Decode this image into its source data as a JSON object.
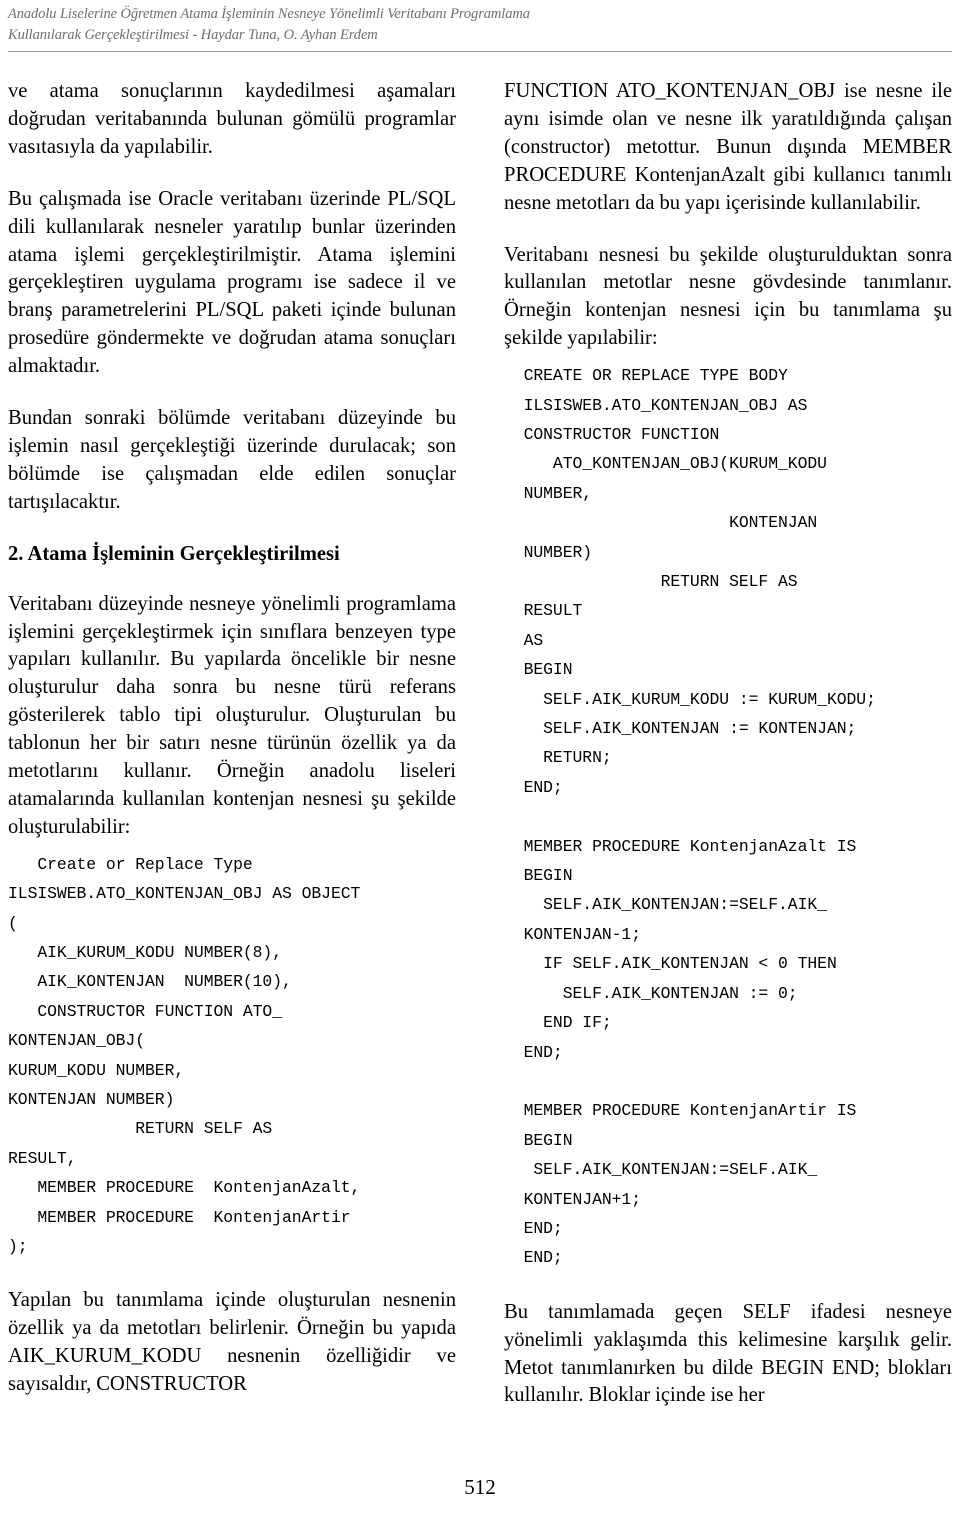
{
  "header": {
    "line1": "Anadolu Liselerine Öğretmen Atama İşleminin Nesneye Yönelimli Veritabanı Programlama",
    "line2": "Kullanılarak Gerçekleştirilmesi - Haydar Tuna, O. Ayhan Erdem"
  },
  "left_column": {
    "para1": "ve atama sonuçlarının kaydedilmesi aşamaları doğrudan veritabanında bulunan gömülü programlar vasıtasıyla da yapılabilir.",
    "para2": "Bu çalışmada ise Oracle veritabanı üzerinde PL/SQL dili kullanılarak nesneler yaratılıp bunlar üzerinden atama işlemi gerçekleştirilmiştir. Atama işlemini gerçekleştiren uygulama programı ise sadece il ve branş parametrelerini PL/SQL paketi içinde bulunan prosedüre göndermekte ve doğrudan atama sonuçları almaktadır.",
    "para3": "Bundan sonraki bölümde veritabanı düzeyinde bu işlemin nasıl gerçekleştiği üzerinde durulacak; son bölümde ise çalışmadan elde edilen sonuçlar tartışılacaktır.",
    "heading": "2. Atama İşleminin Gerçekleştirilmesi",
    "para4": "Veritabanı düzeyinde nesneye yönelimli programlama işlemini gerçekleştirmek için sınıflara benzeyen type yapıları kullanılır. Bu yapılarda öncelikle bir nesne oluşturulur daha sonra bu nesne türü referans gösterilerek tablo tipi oluşturulur. Oluşturulan bu tablonun her bir satırı nesne türünün özellik ya da metotlarını kullanır. Örneğin anadolu liseleri atamalarında kullanılan kontenjan nesnesi şu şekilde oluşturulabilir:",
    "code": "   Create or Replace Type\nILSISWEB.ATO_KONTENJAN_OBJ AS OBJECT\n(\n   AIK_KURUM_KODU NUMBER(8),\n   AIK_KONTENJAN  NUMBER(10),\n   CONSTRUCTOR FUNCTION ATO_\nKONTENJAN_OBJ(\nKURUM_KODU NUMBER,\nKONTENJAN NUMBER)\n             RETURN SELF AS\nRESULT,\n   MEMBER PROCEDURE  KontenjanAzalt,\n   MEMBER PROCEDURE  KontenjanArtir\n);",
    "para5": "Yapılan bu tanımlama içinde oluşturulan nesnenin özellik ya da metotları belirlenir. Örneğin bu yapıda AIK_KURUM_KODU nesnenin özelliğidir ve sayısaldır, CONSTRUCTOR"
  },
  "right_column": {
    "para1": "FUNCTION ATO_KONTENJAN_OBJ ise nesne ile aynı isimde olan ve nesne ilk yaratıldığında çalışan (constructor) metottur. Bunun dışında MEMBER PROCEDURE KontenjanAzalt gibi kullanıcı tanımlı nesne metotları da bu yapı içerisinde kullanılabilir.",
    "para2": "Veritabanı nesnesi bu şekilde oluşturulduktan sonra kullanılan metotlar nesne gövdesinde tanımlanır. Örneğin kontenjan nesnesi için bu tanımlama şu şekilde yapılabilir:",
    "code": "  CREATE OR REPLACE TYPE BODY\n  ILSISWEB.ATO_KONTENJAN_OBJ AS\n  CONSTRUCTOR FUNCTION\n     ATO_KONTENJAN_OBJ(KURUM_KODU\n  NUMBER,\n                       KONTENJAN\n  NUMBER)\n                RETURN SELF AS\n  RESULT\n  AS\n  BEGIN\n    SELF.AIK_KURUM_KODU := KURUM_KODU;\n    SELF.AIK_KONTENJAN := KONTENJAN;\n    RETURN;\n  END;\n\n  MEMBER PROCEDURE KontenjanAzalt IS\n  BEGIN\n    SELF.AIK_KONTENJAN:=SELF.AIK_\n  KONTENJAN-1;\n    IF SELF.AIK_KONTENJAN < 0 THEN\n      SELF.AIK_KONTENJAN := 0;\n    END IF;\n  END;\n\n  MEMBER PROCEDURE KontenjanArtir IS\n  BEGIN\n   SELF.AIK_KONTENJAN:=SELF.AIK_\n  KONTENJAN+1;\n  END;\n  END;",
    "para3": "Bu tanımlamada geçen SELF ifadesi nesneye yönelimli yaklaşımda this kelimesine karşılık gelir. Metot tanımlanırken bu dilde BEGIN END; blokları kullanılır. Bloklar içinde ise her"
  },
  "footer": {
    "page_number": "512"
  }
}
